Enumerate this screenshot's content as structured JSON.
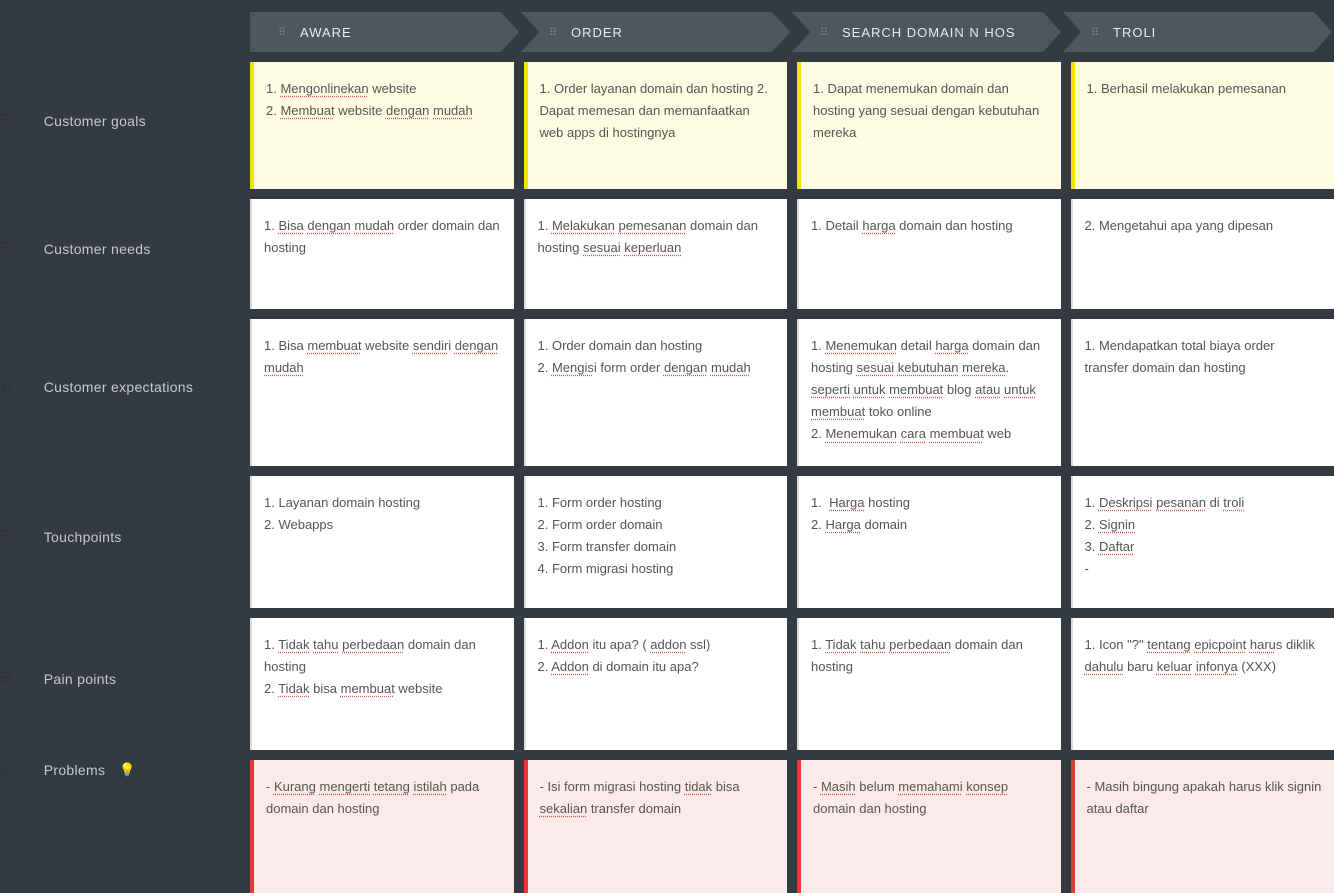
{
  "stages": {
    "aware": "AWARE",
    "order": "ORDER",
    "search": "SEARCH DOMAIN N HOS",
    "troli": "TROLI"
  },
  "rows": {
    "customer_goals": "Customer goals",
    "customer_needs": "Customer needs",
    "customer_expectations": "Customer expectations",
    "touchpoints": "Touchpoints",
    "pain_points": "Pain points",
    "problems": "Problems"
  },
  "cells": {
    "goals_aware": "1. Mengonlinekan website\n2. Membuat website dengan mudah",
    "goals_order": "1. Order layanan domain dan hosting 2. Dapat memesan dan memanfaatkan web apps di hostingnya",
    "goals_search": "1. Dapat menemukan domain dan hosting yang sesuai dengan kebutuhan mereka",
    "goals_troli": "1. Berhasil melakukan pemesanan",
    "needs_aware": "1. Bisa dengan mudah order domain dan hosting",
    "needs_order": "1. Melakukan pemesanan domain dan hosting sesuai keperluan",
    "needs_search": "1. Detail harga domain dan hosting",
    "needs_troli": "2. Mengetahui apa yang dipesan",
    "expect_aware": "1. Bisa membuat website sendiri dengan mudah",
    "expect_order": "1. Order domain dan hosting\n2. Mengisi form order dengan mudah",
    "expect_search": "1. Menemukan detail harga domain dan hosting sesuai kebutuhan mereka. seperti untuk membuat blog atau untuk membuat toko online\n2. Menemukan cara membuat web",
    "expect_troli": "1. Mendapatkan total biaya order transfer domain dan hosting",
    "touch_aware": "1. Layanan domain hosting\n2. Webapps",
    "touch_order": "1. Form order hosting\n2. Form order domain\n3. Form transfer domain\n4. Form migrasi hosting",
    "touch_search": "1.  Harga hosting\n2. Harga domain",
    "touch_troli": "1. Deskripsi pesanan di troli\n2. Signin\n3. Daftar\n-",
    "pain_aware": "1. Tidak tahu perbedaan domain dan hosting\n2. Tidak bisa membuat website",
    "pain_order": "1. Addon itu apa? ( addon ssl)\n2. Addon di domain itu apa?",
    "pain_search": "1. Tidak tahu perbedaan domain dan hosting",
    "pain_troli": "1. Icon \"?\" tentang epicpoint harus diklik dahulu baru keluar infonya (XXX)",
    "prob_aware": "- Kurang mengerti tetang istilah pada domain dan hosting",
    "prob_order": "- Isi form migrasi hosting tidak bisa sekalian transfer domain",
    "prob_search": "- Masih belum memahami konsep domain dan hosting",
    "prob_troli": "- Masih bingung apakah harus klik signin atau daftar"
  }
}
